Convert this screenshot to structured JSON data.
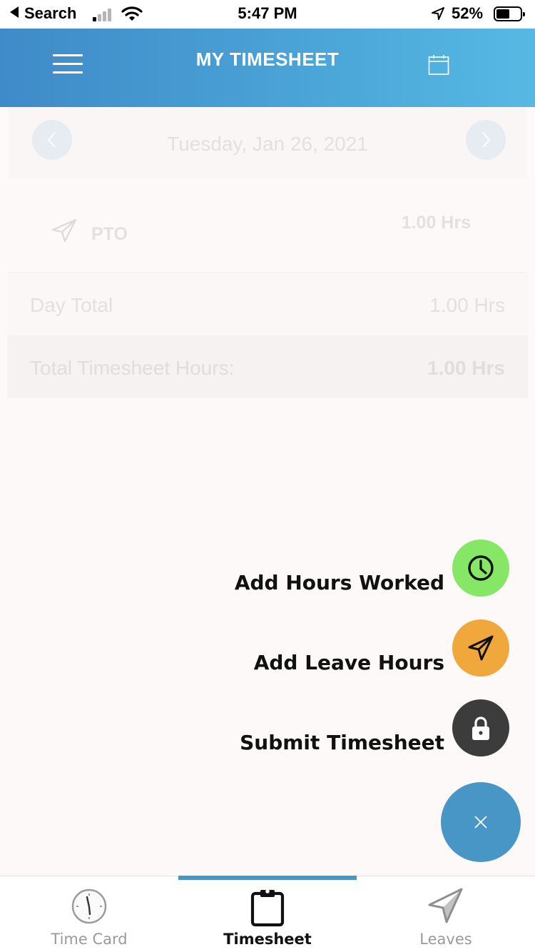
{
  "status_bar": {
    "back_label": "Search",
    "time": "5:47 PM",
    "battery_percent": "52%",
    "signal_bars_active": 1,
    "signal_bars_total": 4,
    "battery_level": 0.52
  },
  "header": {
    "title": "MY TIMESHEET",
    "menu_icon": "hamburger-menu-icon",
    "calendar_icon": "calendar-icon",
    "gradient_start": "#3f8ac8",
    "gradient_end": "#56b9e3"
  },
  "timesheet": {
    "date": "Tuesday, Jan 26, 2021",
    "entries": [
      {
        "type": "PTO",
        "icon": "paper-plane-icon",
        "hours": "1.00 Hrs"
      }
    ],
    "day_total_label": "Day Total",
    "day_total_value": "1.00 Hrs",
    "total_label": "Total Timesheet Hours:",
    "total_value": "1.00 Hrs"
  },
  "fab_menu": {
    "items": [
      {
        "label": "Add Hours Worked",
        "icon": "clock-icon",
        "color": "#86e766"
      },
      {
        "label": "Add Leave Hours",
        "icon": "paper-plane-icon",
        "color": "#f0a73c"
      },
      {
        "label": "Submit Timesheet",
        "icon": "lock-icon",
        "color": "#3c3c3c"
      }
    ],
    "main_icon": "close-icon",
    "main_color": "#4896c5"
  },
  "tab_bar": {
    "tabs": [
      {
        "label": "Time Card",
        "icon": "clock-icon",
        "active": false
      },
      {
        "label": "Timesheet",
        "icon": "clipboard-icon",
        "active": true
      },
      {
        "label": "Leaves",
        "icon": "paper-plane-icon",
        "active": false
      }
    ],
    "accent": "#4896c5"
  }
}
